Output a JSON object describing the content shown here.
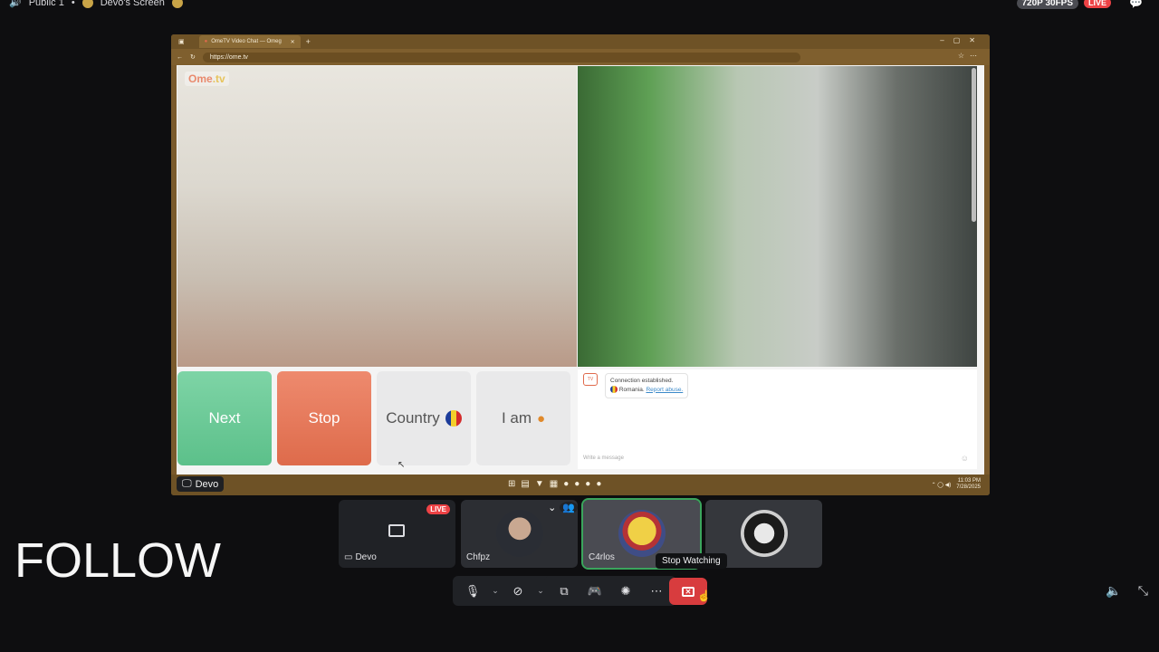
{
  "topbar": {
    "channel": "Public 1",
    "stream_title": "Devo's Screen",
    "resolution": "720P 30FPS",
    "live": "LIVE"
  },
  "browser": {
    "tab_title": "OmeTV Video Chat — Omeg",
    "url": "https://ome.tv",
    "clock_time": "11:03 PM",
    "clock_date": "7/28/2025"
  },
  "ome": {
    "logo_main": "Ome",
    "logo_suffix": ".tv",
    "buttons": {
      "next": "Next",
      "stop": "Stop",
      "country": "Country",
      "iam": "I am"
    },
    "chat": {
      "connection": "Connection established.",
      "country": "Romania.",
      "report": "Report abuse.",
      "placeholder": "Write a message"
    }
  },
  "stream_owner": "Devo",
  "tiles": [
    {
      "name": "Devo",
      "live": "LIVE"
    },
    {
      "name": "Chfpz"
    },
    {
      "name": "C4rlos"
    },
    {
      "name": "vo"
    }
  ],
  "tooltip": "Stop Watching",
  "overlay_text": "FOLLOW",
  "colors": {
    "live_red": "#ed4245",
    "next_green": "#5cc08a",
    "stop_orange": "#de6b4b",
    "speaking_green": "#3ba55d"
  },
  "icons": {
    "mic": "microphone-icon",
    "camera": "camera-off-icon",
    "screen": "screen-share-icon",
    "activity": "game-controller-icon",
    "soundboard": "soundboard-icon",
    "more": "more-icon",
    "stop_watch": "stop-watching-icon",
    "volume": "volume-icon",
    "fullscreen": "exit-fullscreen-icon"
  }
}
